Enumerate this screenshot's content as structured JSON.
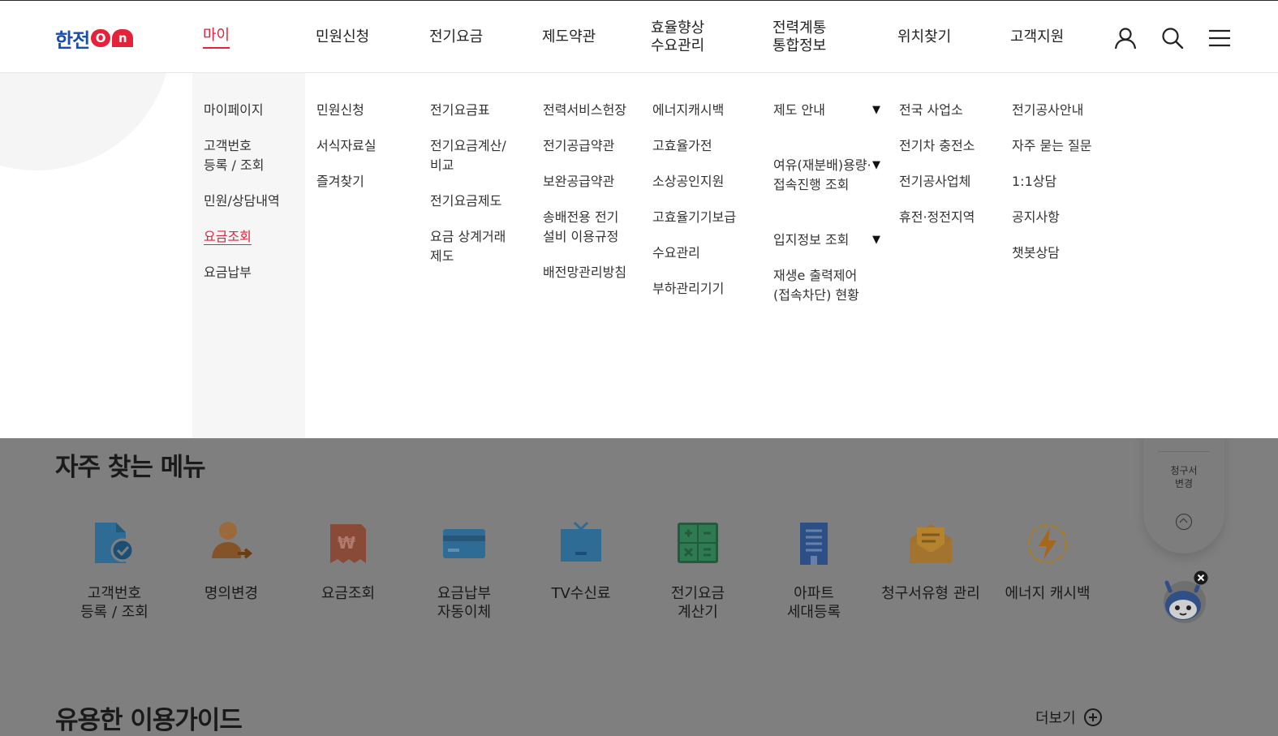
{
  "brand": {
    "logo_text": "한전",
    "logo_on_o": "O",
    "logo_on_n": "n"
  },
  "gnb": {
    "items": [
      {
        "label": "마이",
        "active": true
      },
      {
        "label": "민원신청"
      },
      {
        "label": "전기요금"
      },
      {
        "label": "제도약관"
      },
      {
        "label": "효율향상\n수요관리"
      },
      {
        "label": "전력계통\n통합정보"
      },
      {
        "label": "위치찾기"
      },
      {
        "label": "고객지원"
      }
    ],
    "icons": [
      "user-icon",
      "search-icon",
      "hamburger-menu-icon"
    ]
  },
  "mega_menu": {
    "col1": [
      "마이페이지",
      "고객번호\n등록 / 조회",
      "민원/상담내역",
      "요금조회",
      "요금납부"
    ],
    "col1_active": "요금조회",
    "col2": [
      "민원신청",
      "서식자료실",
      "즐겨찾기"
    ],
    "col3": [
      "전기요금표",
      "전기요금계산/\n비교",
      "전기요금제도",
      "요금 상계거래\n제도"
    ],
    "col4": [
      "전력서비스헌장",
      "전기공급약관",
      "보완공급약관",
      "송배전용 전기\n설비 이용규정",
      "배전망관리방침"
    ],
    "col5": [
      "에너지캐시백",
      "고효율가전",
      "소상공인지원",
      "고효율기기보급",
      "수요관리",
      "부하관리기기"
    ],
    "col6": [
      "제도 안내",
      "여유(재분배)용량·\n접속진행 조회",
      "입지정보 조회",
      "재생e 출력제어\n(접속차단) 현황"
    ],
    "col6_triangle": "▼",
    "col7": [
      "전국 사업소",
      "전기차 충전소",
      "전기공사업체",
      "휴전·정전지역"
    ],
    "col8": [
      "전기공사안내",
      "자주 묻는 질문",
      "1:1상담",
      "공지사항",
      "챗봇상담"
    ]
  },
  "frequent_menu": {
    "title": "자주 찾는 메뉴",
    "items": [
      {
        "label": "고객번호\n등록 / 조회",
        "icon": "document-check-icon"
      },
      {
        "label": "명의변경",
        "icon": "person-change-icon"
      },
      {
        "label": "요금조회",
        "icon": "won-receipt-icon"
      },
      {
        "label": "요금납부\n자동이체",
        "icon": "credit-card-icon"
      },
      {
        "label": "TV수신료",
        "icon": "tv-icon"
      },
      {
        "label": "전기요금\n계산기",
        "icon": "calculator-icon"
      },
      {
        "label": "아파트\n세대등록",
        "icon": "apartment-icon"
      },
      {
        "label": "청구서유형 관리",
        "icon": "mail-envelope-icon"
      },
      {
        "label": "에너지 캐시백",
        "icon": "lightning-bolt-icon"
      }
    ]
  },
  "guide": {
    "title": "유용한 이용가이드",
    "more_label": "더보기"
  },
  "side_panel": {
    "label": "청구서\n변경"
  },
  "colors": {
    "brand_red": "#e4223a",
    "brand_blue": "#1b4ea8",
    "dim": "#7f7f7f"
  }
}
